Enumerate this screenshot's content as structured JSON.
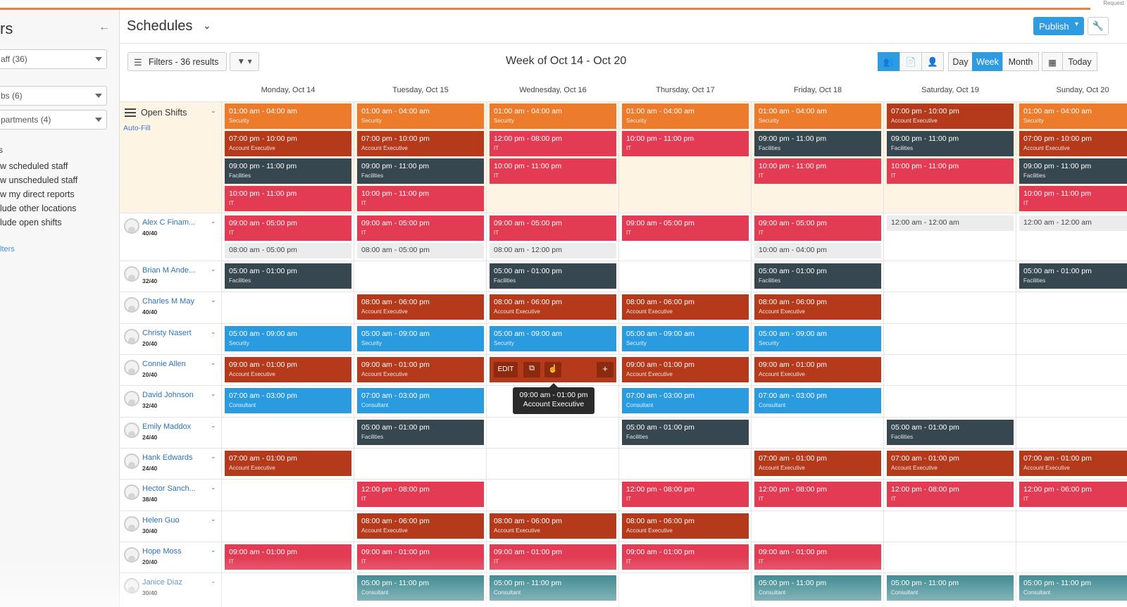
{
  "corner_text": "Request",
  "sidebar": {
    "title": "rs",
    "back_icon": "arrow-left-icon",
    "selects": [
      {
        "value": "aff (36)"
      },
      {
        "value": "bs (6)"
      },
      {
        "value": "partments (4)"
      }
    ],
    "heading": "s",
    "options": [
      {
        "label": "w scheduled staff"
      },
      {
        "label": "w unscheduled staff"
      },
      {
        "label": "w my direct reports"
      },
      {
        "label": "lude other locations"
      },
      {
        "label": "lude open shifts"
      }
    ],
    "link": "lters"
  },
  "header": {
    "title": "Schedules",
    "publish_label": "Publish"
  },
  "toolbar": {
    "filters_label": "Filters - 36 results",
    "week_title": "Week of Oct 14 - Oct 20",
    "view_day": "Day",
    "view_week": "Week",
    "view_month": "Month",
    "today_label": "Today"
  },
  "days": [
    "Monday, Oct 14",
    "Tuesday, Oct 15",
    "Wednesday, Oct 16",
    "Thursday, Oct 17",
    "Friday, Oct 18",
    "Saturday, Oct 19",
    "Sunday, Oct 20"
  ],
  "open_shifts": {
    "label": "Open Shifts",
    "autofill": "Auto-Fill",
    "shifts": [
      {
        "day": 0,
        "slot": 0,
        "time": "01:00 am - 04:00 am",
        "role": "Security",
        "color": "orange"
      },
      {
        "day": 0,
        "slot": 1,
        "time": "07:00 pm - 10:00 pm",
        "role": "Account Executive",
        "color": "rust"
      },
      {
        "day": 0,
        "slot": 2,
        "time": "09:00 pm - 11:00 pm",
        "role": "Facilities",
        "color": "slate"
      },
      {
        "day": 0,
        "slot": 3,
        "time": "10:00 pm - 11:00 pm",
        "role": "IT",
        "color": "red"
      },
      {
        "day": 1,
        "slot": 0,
        "time": "01:00 am - 04:00 am",
        "role": "Security",
        "color": "orange"
      },
      {
        "day": 1,
        "slot": 1,
        "time": "07:00 pm - 10:00 pm",
        "role": "Account Executive",
        "color": "rust"
      },
      {
        "day": 1,
        "slot": 2,
        "time": "09:00 pm - 11:00 pm",
        "role": "Facilities",
        "color": "slate"
      },
      {
        "day": 1,
        "slot": 3,
        "time": "10:00 pm - 11:00 pm",
        "role": "IT",
        "color": "red"
      },
      {
        "day": 2,
        "slot": 0,
        "time": "01:00 am - 04:00 am",
        "role": "Security",
        "color": "orange"
      },
      {
        "day": 2,
        "slot": 1,
        "time": "12:00 pm - 08:00 pm",
        "role": "IT",
        "color": "red"
      },
      {
        "day": 2,
        "slot": 2,
        "time": "10:00 pm - 11:00 pm",
        "role": "IT",
        "color": "red"
      },
      {
        "day": 3,
        "slot": 0,
        "time": "01:00 am - 04:00 am",
        "role": "Security",
        "color": "orange"
      },
      {
        "day": 3,
        "slot": 1,
        "time": "10:00 pm - 11:00 pm",
        "role": "IT",
        "color": "red"
      },
      {
        "day": 4,
        "slot": 0,
        "time": "01:00 am - 04:00 am",
        "role": "Security",
        "color": "orange"
      },
      {
        "day": 4,
        "slot": 1,
        "time": "09:00 pm - 11:00 pm",
        "role": "Facilities",
        "color": "slate"
      },
      {
        "day": 4,
        "slot": 2,
        "time": "10:00 pm - 11:00 pm",
        "role": "IT",
        "color": "red"
      },
      {
        "day": 5,
        "slot": 0,
        "time": "07:00 pm - 10:00 pm",
        "role": "Account Executive",
        "color": "rust"
      },
      {
        "day": 5,
        "slot": 1,
        "time": "09:00 pm - 11:00 pm",
        "role": "Facilities",
        "color": "slate"
      },
      {
        "day": 5,
        "slot": 2,
        "time": "10:00 pm - 11:00 pm",
        "role": "IT",
        "color": "red"
      },
      {
        "day": 6,
        "slot": 0,
        "time": "01:00 am - 04:00 am",
        "role": "Security",
        "color": "orange"
      },
      {
        "day": 6,
        "slot": 1,
        "time": "07:00 pm - 10:00 pm",
        "role": "Account Executive",
        "color": "rust"
      },
      {
        "day": 6,
        "slot": 2,
        "time": "09:00 pm - 11:00 pm",
        "role": "Facilities",
        "color": "slate"
      },
      {
        "day": 6,
        "slot": 3,
        "time": "10:00 pm - 11:00 pm",
        "role": "IT",
        "color": "red"
      }
    ]
  },
  "employees": [
    {
      "name": "Alex C Finam...",
      "hours": "40/40",
      "shifts": [
        {
          "day": 0,
          "time": "09:00 am - 05:00 pm",
          "role": "IT",
          "color": "red"
        },
        {
          "day": 1,
          "time": "09:00 am - 05:00 pm",
          "role": "IT",
          "color": "red"
        },
        {
          "day": 2,
          "time": "09:00 am - 05:00 pm",
          "role": "IT",
          "color": "red"
        },
        {
          "day": 3,
          "time": "09:00 am - 05:00 pm",
          "role": "IT",
          "color": "red"
        },
        {
          "day": 4,
          "time": "09:00 am - 05:00 pm",
          "role": "IT",
          "color": "red"
        }
      ],
      "availability": [
        {
          "day": 0,
          "time": "08:00 am - 05:00 pm",
          "row": 1
        },
        {
          "day": 1,
          "time": "08:00 am - 05:00 pm",
          "row": 1
        },
        {
          "day": 2,
          "time": "08:00 am - 12:00 pm",
          "row": 1
        },
        {
          "day": 4,
          "time": "10:00 am - 04:00 pm",
          "row": 1
        },
        {
          "day": 5,
          "time": "12:00 am - 12:00 am",
          "row": 0
        },
        {
          "day": 6,
          "time": "12:00 am - 12:00 am",
          "row": 0
        }
      ]
    },
    {
      "name": "Brian M Ande...",
      "hours": "32/40",
      "shifts": [
        {
          "day": 0,
          "time": "05:00 am - 01:00 pm",
          "role": "Facilities",
          "color": "slate"
        },
        {
          "day": 2,
          "time": "05:00 am - 01:00 pm",
          "role": "Facilities",
          "color": "slate"
        },
        {
          "day": 4,
          "time": "05:00 am - 01:00 pm",
          "role": "Facilities",
          "color": "slate"
        },
        {
          "day": 6,
          "time": "05:00 am - 01:00 pm",
          "role": "Facilities",
          "color": "slate"
        }
      ]
    },
    {
      "name": "Charles M May",
      "hours": "40/40",
      "shifts": [
        {
          "day": 1,
          "time": "08:00 am - 06:00 pm",
          "role": "Account Executive",
          "color": "rust"
        },
        {
          "day": 2,
          "time": "08:00 am - 06:00 pm",
          "role": "Account Executive",
          "color": "rust"
        },
        {
          "day": 3,
          "time": "08:00 am - 06:00 pm",
          "role": "Account Executive",
          "color": "rust"
        },
        {
          "day": 4,
          "time": "08:00 am - 06:00 pm",
          "role": "Account Executive",
          "color": "rust"
        }
      ]
    },
    {
      "name": "Christy Nasert",
      "hours": "20/40",
      "shifts": [
        {
          "day": 0,
          "time": "05:00 am - 09:00 am",
          "role": "Security",
          "color": "blue"
        },
        {
          "day": 1,
          "time": "05:00 am - 09:00 am",
          "role": "Security",
          "color": "blue"
        },
        {
          "day": 2,
          "time": "05:00 am - 09:00 am",
          "role": "Security",
          "color": "blue"
        },
        {
          "day": 3,
          "time": "05:00 am - 09:00 am",
          "role": "Security",
          "color": "blue"
        },
        {
          "day": 4,
          "time": "05:00 am - 09:00 am",
          "role": "Security",
          "color": "blue"
        }
      ]
    },
    {
      "name": "Connie Allen",
      "hours": "20/40",
      "shifts": [
        {
          "day": 0,
          "time": "09:00 am - 01:00 pm",
          "role": "Account Executive",
          "color": "rust"
        },
        {
          "day": 1,
          "time": "09:00 am - 01:00 pm",
          "role": "Account Executive",
          "color": "rust"
        },
        {
          "day": 3,
          "time": "09:00 am - 01:00 pm",
          "role": "Account Executive",
          "color": "rust"
        },
        {
          "day": 4,
          "time": "09:00 am - 01:00 pm",
          "role": "Account Executive",
          "color": "rust"
        }
      ]
    },
    {
      "name": "David Johnson",
      "hours": "32/40",
      "shifts": [
        {
          "day": 0,
          "time": "07:00 am - 03:00 pm",
          "role": "Consultant",
          "color": "blue"
        },
        {
          "day": 1,
          "time": "07:00 am - 03:00 pm",
          "role": "Consultant",
          "color": "blue"
        },
        {
          "day": 3,
          "time": "07:00 am - 03:00 pm",
          "role": "Consultant",
          "color": "blue"
        },
        {
          "day": 4,
          "time": "07:00 am - 03:00 pm",
          "role": "Consultant",
          "color": "blue"
        }
      ]
    },
    {
      "name": "Emily Maddox",
      "hours": "24/40",
      "shifts": [
        {
          "day": 1,
          "time": "05:00 am - 01:00 pm",
          "role": "Facilities",
          "color": "slate"
        },
        {
          "day": 3,
          "time": "05:00 am - 01:00 pm",
          "role": "Facilities",
          "color": "slate"
        },
        {
          "day": 5,
          "time": "05:00 am - 01:00 pm",
          "role": "Facilities",
          "color": "slate"
        }
      ]
    },
    {
      "name": "Hank Edwards",
      "hours": "24/40",
      "shifts": [
        {
          "day": 0,
          "time": "07:00 am - 01:00 pm",
          "role": "Account Executive",
          "color": "rust"
        },
        {
          "day": 4,
          "time": "07:00 am - 01:00 pm",
          "role": "Account Executive",
          "color": "rust"
        },
        {
          "day": 5,
          "time": "07:00 am - 01:00 pm",
          "role": "Account Executive",
          "color": "rust"
        },
        {
          "day": 6,
          "time": "07:00 am - 01:00 pm",
          "role": "Account Executive",
          "color": "rust"
        }
      ]
    },
    {
      "name": "Hector Sanch...",
      "hours": "38/40",
      "shifts": [
        {
          "day": 1,
          "time": "12:00 pm - 08:00 pm",
          "role": "IT",
          "color": "red"
        },
        {
          "day": 3,
          "time": "12:00 pm - 08:00 pm",
          "role": "IT",
          "color": "red"
        },
        {
          "day": 4,
          "time": "12:00 pm - 08:00 pm",
          "role": "IT",
          "color": "red"
        },
        {
          "day": 5,
          "time": "12:00 pm - 08:00 pm",
          "role": "IT",
          "color": "red"
        },
        {
          "day": 6,
          "time": "12:00 pm - 06:00 pm",
          "role": "IT",
          "color": "red"
        }
      ]
    },
    {
      "name": "Helen Guo",
      "hours": "30/40",
      "shifts": [
        {
          "day": 1,
          "time": "08:00 am - 06:00 pm",
          "role": "Account Executive",
          "color": "rust"
        },
        {
          "day": 2,
          "time": "08:00 am - 06:00 pm",
          "role": "Account Executive",
          "color": "rust"
        },
        {
          "day": 3,
          "time": "08:00 am - 06:00 pm",
          "role": "Account Executive",
          "color": "rust"
        }
      ]
    },
    {
      "name": "Hope Moss",
      "hours": "20/40",
      "shifts": [
        {
          "day": 0,
          "time": "09:00 am - 01:00 pm",
          "role": "IT",
          "color": "red"
        },
        {
          "day": 1,
          "time": "09:00 am - 01:00 pm",
          "role": "IT",
          "color": "red"
        },
        {
          "day": 2,
          "time": "09:00 am - 01:00 pm",
          "role": "IT",
          "color": "red"
        },
        {
          "day": 3,
          "time": "09:00 am - 01:00 pm",
          "role": "IT",
          "color": "red"
        },
        {
          "day": 4,
          "time": "09:00 am - 01:00 pm",
          "role": "IT",
          "color": "red"
        }
      ]
    },
    {
      "name": "Janice Diaz",
      "hours": "30/40",
      "shifts": [
        {
          "day": 1,
          "time": "05:00 pm - 11:00 pm",
          "role": "Consultant",
          "color": "teal"
        },
        {
          "day": 2,
          "time": "05:00 pm - 11:00 pm",
          "role": "Consultant",
          "color": "teal"
        },
        {
          "day": 4,
          "time": "05:00 pm - 11:00 pm",
          "role": "Consultant",
          "color": "teal"
        },
        {
          "day": 5,
          "time": "05:00 pm - 11:00 pm",
          "role": "Consultant",
          "color": "teal"
        },
        {
          "day": 6,
          "time": "05:00 pm - 11:00 pm",
          "role": "Consultant",
          "color": "teal"
        }
      ]
    }
  ],
  "hover_card": {
    "edit_label": "EDIT",
    "copy_icon": "copy-icon",
    "move_icon": "hand-cursor-icon",
    "add_label": "+",
    "tooltip_time": "09:00 am - 01:00 pm",
    "tooltip_role": "Account Executive"
  },
  "colors": {
    "orange": "#ec7c2c",
    "rust": "#b43a1b",
    "slate": "#37474f",
    "red": "#e23b53",
    "blue": "#2b9be0",
    "teal": "#106f78",
    "accent": "#2f9be0",
    "top_line": "#e8833a"
  }
}
